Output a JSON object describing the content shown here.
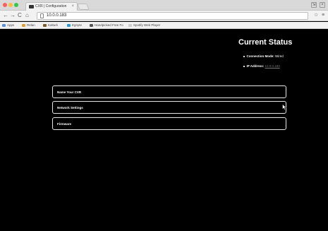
{
  "browser": {
    "tab_title": "CXR | Configuration",
    "tab_close": "×",
    "url": "10.0.0.183",
    "window_buttons": [
      "⇲",
      "×"
    ]
  },
  "bookmarks": [
    {
      "label": "Apps",
      "color": "#5a8fd8"
    },
    {
      "label": "Relan",
      "color": "#e0a030"
    },
    {
      "label": "Kalturk",
      "color": "#7a5a2a"
    },
    {
      "label": "Egnyte",
      "color": "#2a9ad0"
    },
    {
      "label": "Handpicked Free Fo",
      "color": "#555555"
    },
    {
      "label": "Spotify Web Player",
      "color": "#cccccc"
    }
  ],
  "status": {
    "title": "Current Status",
    "connection_label": "Connection Mode:",
    "connection_value": "Wired",
    "ip_label": "IP Address:",
    "ip_value": "10.0.0.183"
  },
  "panels": [
    {
      "label": "Name Your CXR"
    },
    {
      "label": "Network Settings"
    },
    {
      "label": "Firmware"
    }
  ]
}
